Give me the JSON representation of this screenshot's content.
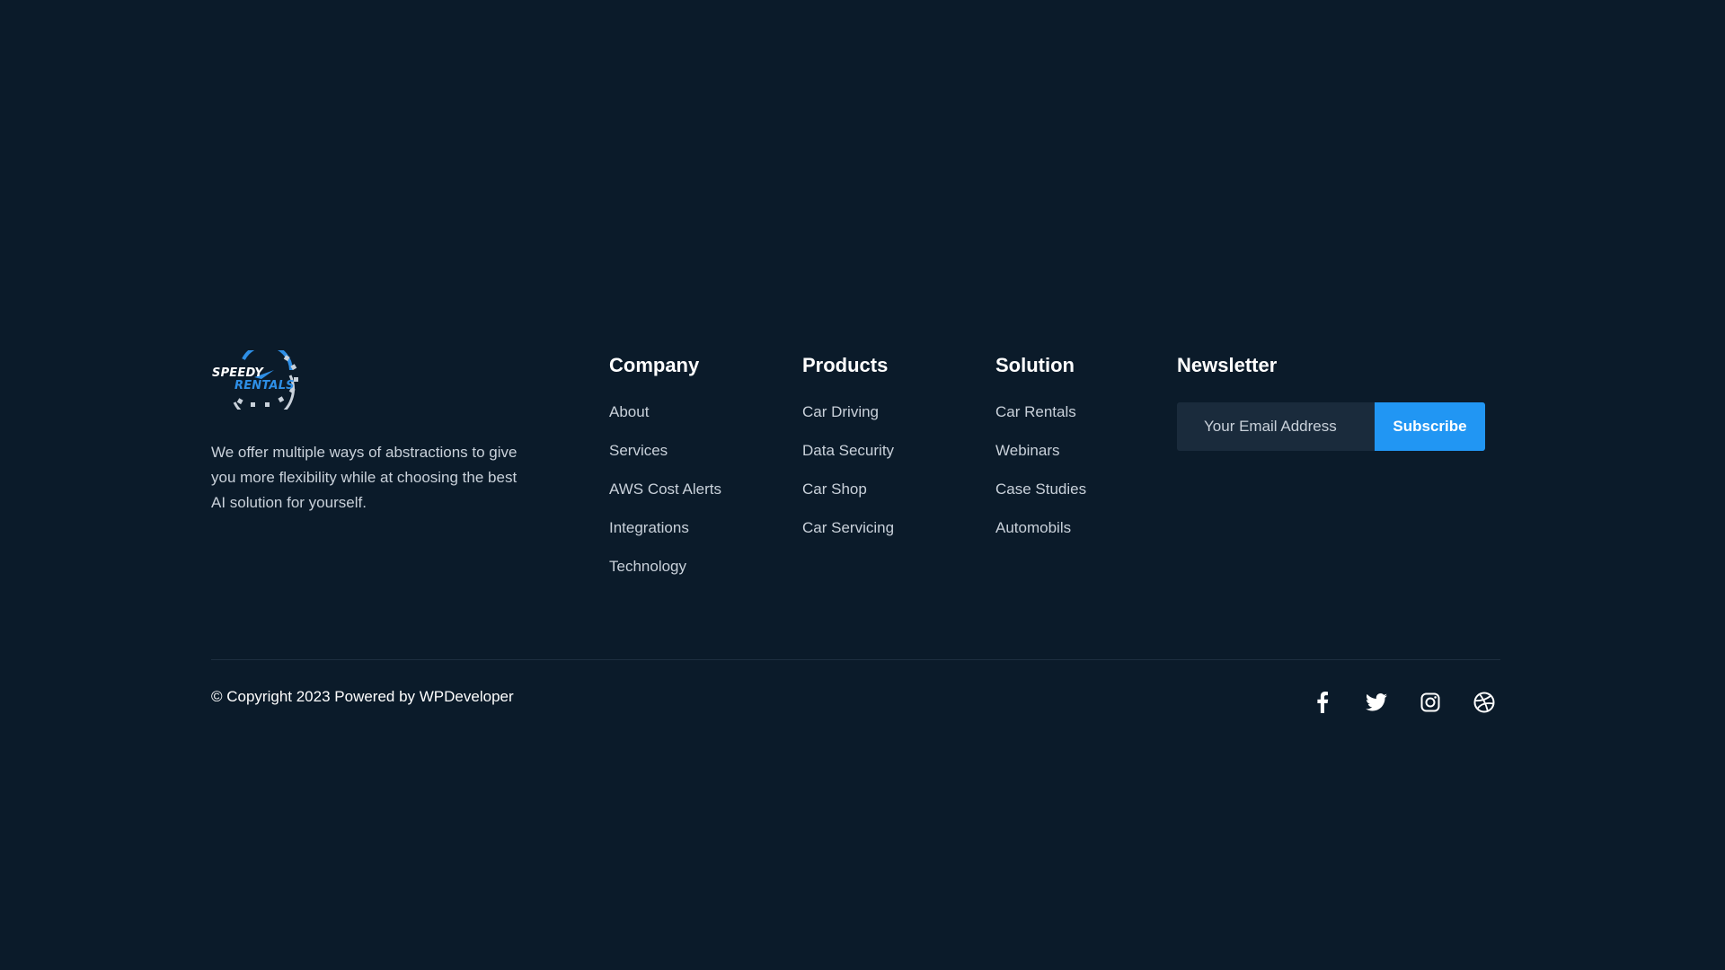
{
  "brand": {
    "logo_line1": "SPEEDY",
    "logo_line2": "RENTALS",
    "description": "We offer multiple ways of abstractions to give you more flexibility while at choosing the best AI solution for yourself."
  },
  "columns": [
    {
      "title": "Company",
      "links": [
        "About",
        "Services",
        "AWS Cost Alerts",
        "Integrations",
        "Technology"
      ]
    },
    {
      "title": "Products",
      "links": [
        "Car Driving",
        "Data Security",
        "Car Shop",
        "Car Servicing"
      ]
    },
    {
      "title": "Solution",
      "links": [
        "Car Rentals",
        "Webinars",
        "Case Studies",
        "Automobils"
      ]
    }
  ],
  "newsletter": {
    "title": "Newsletter",
    "email_placeholder": "Your Email Address",
    "email_value": "",
    "subscribe_label": "Subscribe"
  },
  "bottom": {
    "copyright": "© Copyright 2023 Powered by WPDeveloper",
    "socials": [
      "facebook-icon",
      "twitter-icon",
      "instagram-icon",
      "dribbble-icon"
    ]
  },
  "colors": {
    "background": "#0b1b2a",
    "accent": "#2196f3",
    "input_bg": "#1a2b3c",
    "text_muted": "#c9d1da",
    "text_white": "#ffffff"
  }
}
